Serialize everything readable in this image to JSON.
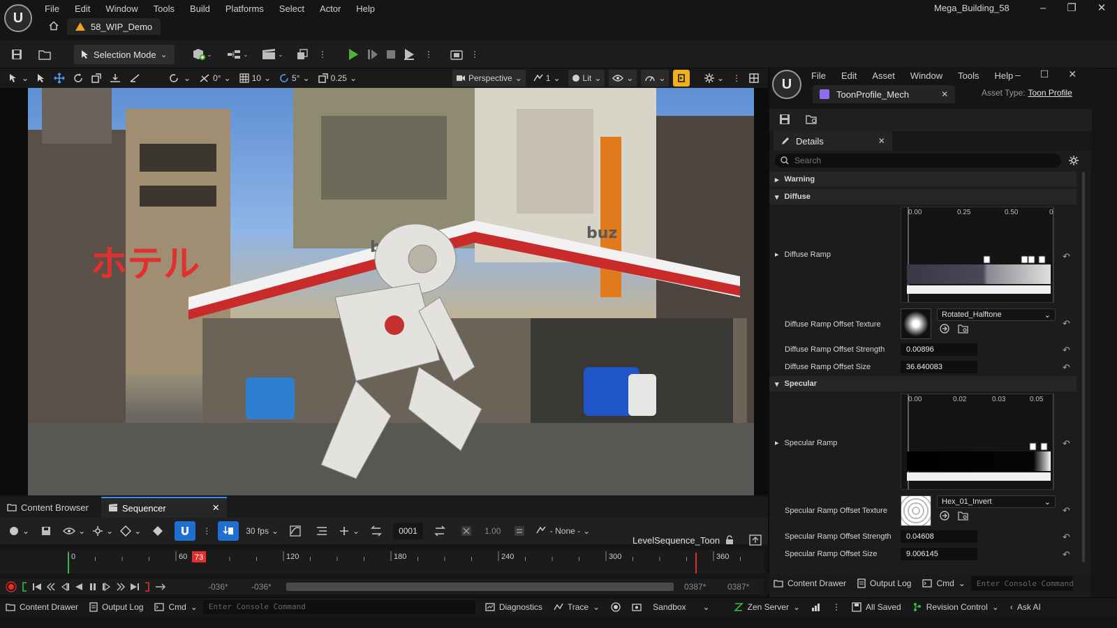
{
  "app": {
    "menu": [
      "File",
      "Edit",
      "Window",
      "Tools",
      "Build",
      "Platforms",
      "Select",
      "Actor",
      "Help"
    ],
    "project_name": "Mega_Building_58",
    "level_tab": "58_WIP_Demo"
  },
  "toolbar": {
    "selection_mode": "Selection Mode"
  },
  "viewport_toolbar": {
    "rotate_snap": "0°",
    "grid_snap": "10",
    "angle_snap": "5°",
    "scale_snap": "0.25",
    "perspective": "Perspective",
    "cam_speed": "1",
    "lit": "Lit"
  },
  "viewport_scene": {
    "sign_hotel": "ホテル",
    "sign_buz": "buz"
  },
  "bottom_tabs": {
    "content_browser": "Content Browser",
    "sequencer": "Sequencer"
  },
  "sequencer": {
    "fps": "30 fps",
    "frame": "0001",
    "speed": "1.00",
    "none": "- None -",
    "sequence_name": "LevelSequence_Toon",
    "ruler": [
      "0",
      "60",
      "120",
      "180",
      "240",
      "300",
      "360"
    ],
    "playhead": "73",
    "start_a": "-036*",
    "start_b": "-036*",
    "end_a": "0387*",
    "end_b": "0387*"
  },
  "details_window": {
    "menu": [
      "File",
      "Edit",
      "Asset",
      "Window",
      "Tools",
      "Help"
    ],
    "asset_tab": "ToonProfile_Mech",
    "asset_type_label": "Asset Type:",
    "asset_type_value": "Toon Profile",
    "details_tab": "Details",
    "search_placeholder": "Search",
    "cat_warning": "Warning",
    "cat_diffuse": "Diffuse",
    "cat_specular": "Specular",
    "diffuse_ramp_label": "Diffuse Ramp",
    "diffuse_ticks": [
      "0.00",
      "0.25",
      "0.50",
      "0"
    ],
    "diffuse_offset_tex_label": "Diffuse Ramp Offset Texture",
    "diffuse_offset_tex_value": "Rotated_Halftone",
    "diffuse_offset_strength_label": "Diffuse Ramp Offset Strength",
    "diffuse_offset_strength_value": "0.00896",
    "diffuse_offset_size_label": "Diffuse Ramp Offset Size",
    "diffuse_offset_size_value": "36.640083",
    "specular_ramp_label": "Specular Ramp",
    "specular_ticks": [
      "0.00",
      "0.02",
      "0.03",
      "0.05"
    ],
    "specular_offset_tex_label": "Specular Ramp Offset Texture",
    "specular_offset_tex_value": "Hex_01_Invert",
    "specular_offset_strength_label": "Specular Ramp Offset Strength",
    "specular_offset_strength_value": "0.04608",
    "specular_offset_size_label": "Specular Ramp Offset Size",
    "specular_offset_size_value": "9.006145",
    "footer_content_drawer": "Content Drawer",
    "footer_output_log": "Output Log",
    "footer_cmd": "Cmd",
    "footer_console_placeholder": "Enter Console Command"
  },
  "statusbar": {
    "content_drawer": "Content Drawer",
    "output_log": "Output Log",
    "cmd": "Cmd",
    "console_placeholder": "Enter Console Command",
    "diagnostics": "Diagnostics",
    "trace": "Trace",
    "sandbox": "Sandbox",
    "zen_server": "Zen Server",
    "all_saved": "All Saved",
    "revision_control": "Revision Control",
    "ask_ai": "Ask AI"
  },
  "colors": {
    "accent_blue": "#1f6fd1",
    "play_green": "#4fb33a",
    "playhead_red": "#e03030",
    "snap_orange": "#f2b01e"
  }
}
